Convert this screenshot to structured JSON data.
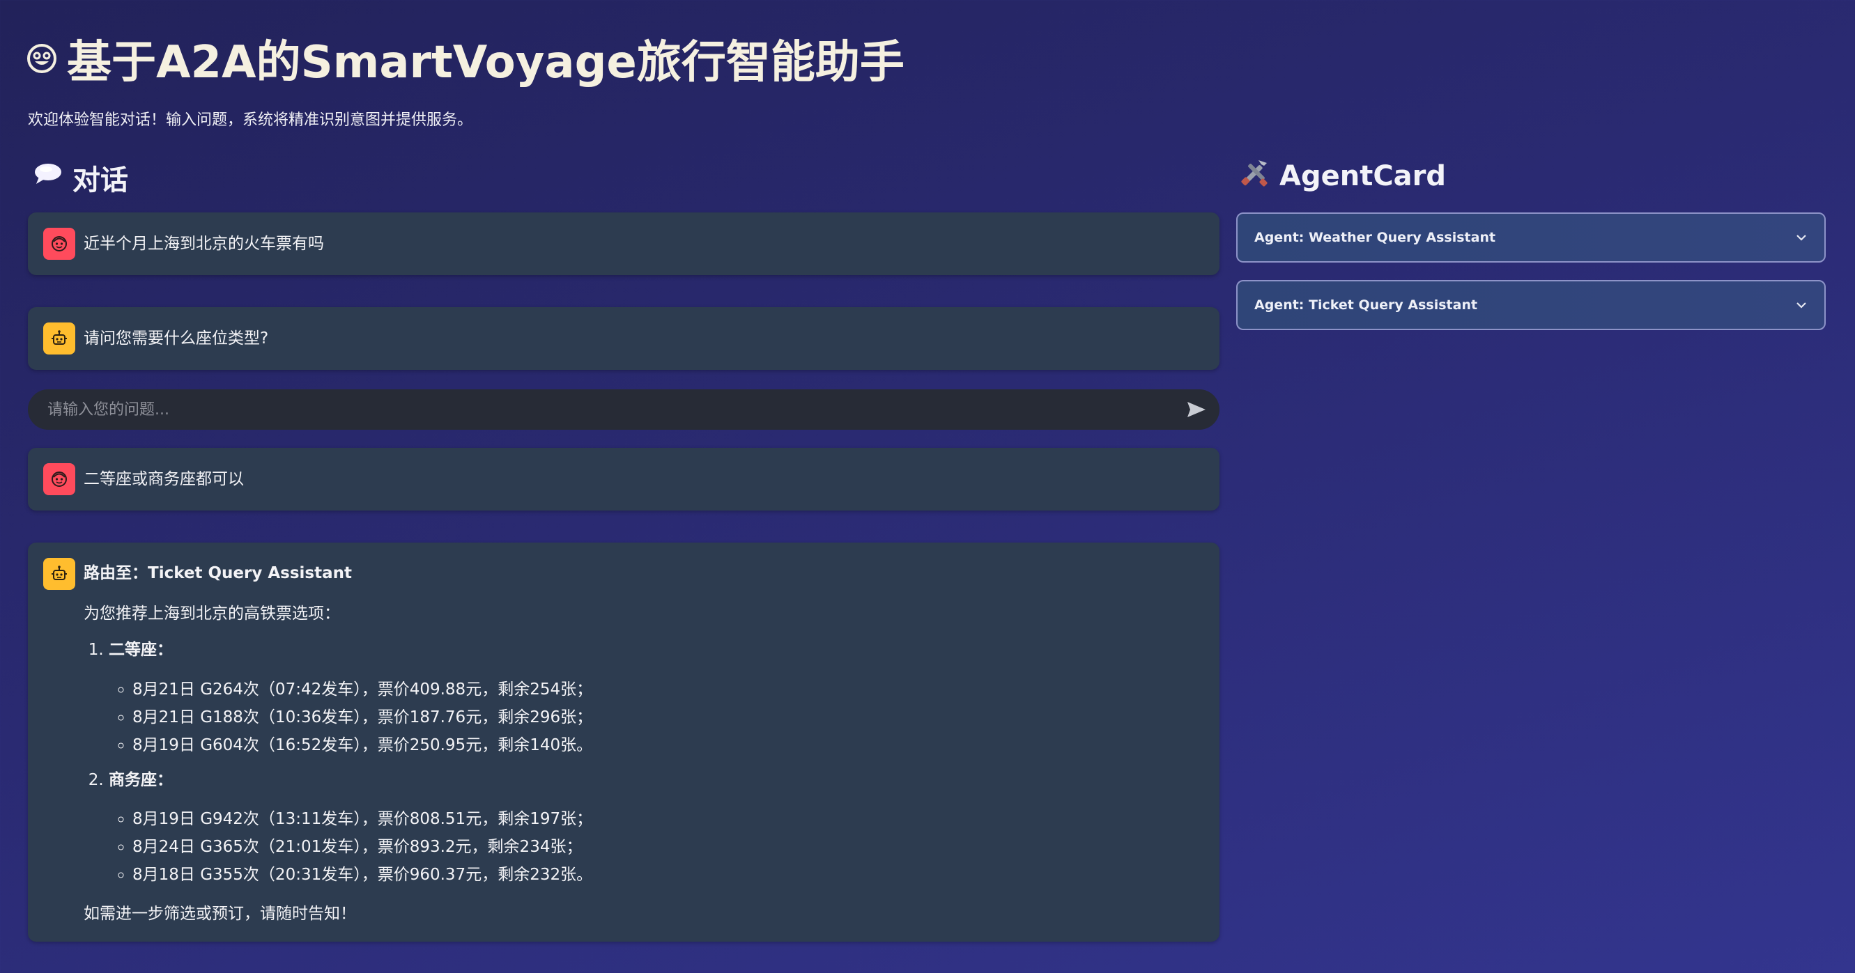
{
  "header": {
    "title": "基于A2A的SmartVoyage旅行智能助手",
    "title_icon": "smiley-icon",
    "subtitle": "欢迎体验智能对话！输入问题，系统将精准识别意图并提供服务。"
  },
  "chat": {
    "heading": "对话",
    "heading_icon": "speech-bubble-icon",
    "messages": [
      {
        "role": "user",
        "text": "近半个月上海到北京的火车票有吗"
      },
      {
        "role": "assistant",
        "text": "请问您需要什么座位类型?"
      }
    ],
    "input": {
      "placeholder": "请输入您的问题...",
      "value": ""
    },
    "messages_after": [
      {
        "role": "user",
        "text": "二等座或商务座都可以"
      }
    ],
    "response": {
      "route": "路由至：Ticket Query Assistant",
      "intro": "为您推荐上海到北京的高铁票选项：",
      "categories": [
        {
          "name": "二等座：",
          "items": [
            "8月21日 G264次（07:42发车），票价409.88元，剩余254张；",
            "8月21日 G188次（10:36发车），票价187.76元，剩余296张；",
            "8月19日 G604次（16:52发车），票价250.95元，剩余140张。"
          ]
        },
        {
          "name": "商务座：",
          "items": [
            "8月19日 G942次（13:11发车），票价808.51元，剩余197张；",
            "8月24日 G365次（21:01发车），票价893.2元，剩余234张；",
            "8月18日 G355次（20:31发车），票价960.37元，剩余232张。"
          ]
        }
      ],
      "outro": "如需进一步筛选或预订，请随时告知！"
    }
  },
  "agents": {
    "heading": "AgentCard",
    "heading_icon": "tools-icon",
    "cards": [
      {
        "label": "Agent: Weather Query Assistant"
      },
      {
        "label": "Agent: Ticket Query Assistant"
      }
    ]
  },
  "colors": {
    "user_avatar": "#ff4b5c",
    "bot_avatar": "#ffbd2e",
    "bubble_bg": "#2d3c50",
    "input_bg": "#272b36"
  }
}
